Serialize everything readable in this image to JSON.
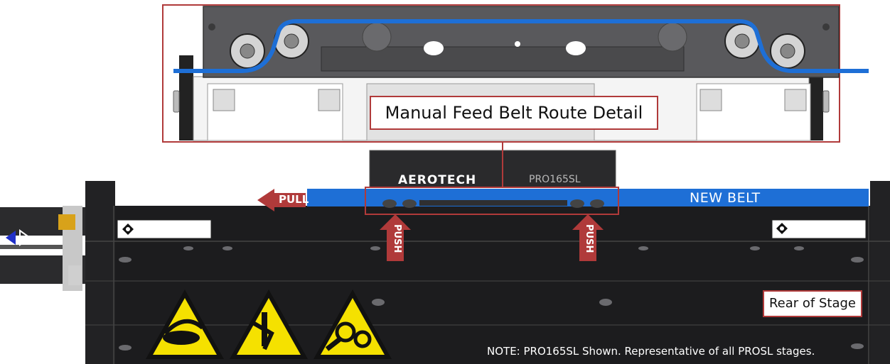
{
  "detail": {
    "title": "Manual Feed Belt Route Detail"
  },
  "stage": {
    "brand": "AEROTECH",
    "model": "PRO165SL",
    "new_belt_label": "NEW BELT",
    "pull_label": "PULL",
    "push_label": "PUSH",
    "rear_label": "Rear of Stage",
    "note": "NOTE: PRO165SL Shown. Representative of all PROSL stages."
  },
  "colors": {
    "belt": "#1e6fd6",
    "callout": "#b03a3a",
    "body": "#1c1c1e",
    "warning": "#f5e100"
  },
  "icons": [
    "belt-entanglement-warning-icon",
    "hand-crush-warning-icon",
    "gear-entanglement-warning-icon"
  ]
}
